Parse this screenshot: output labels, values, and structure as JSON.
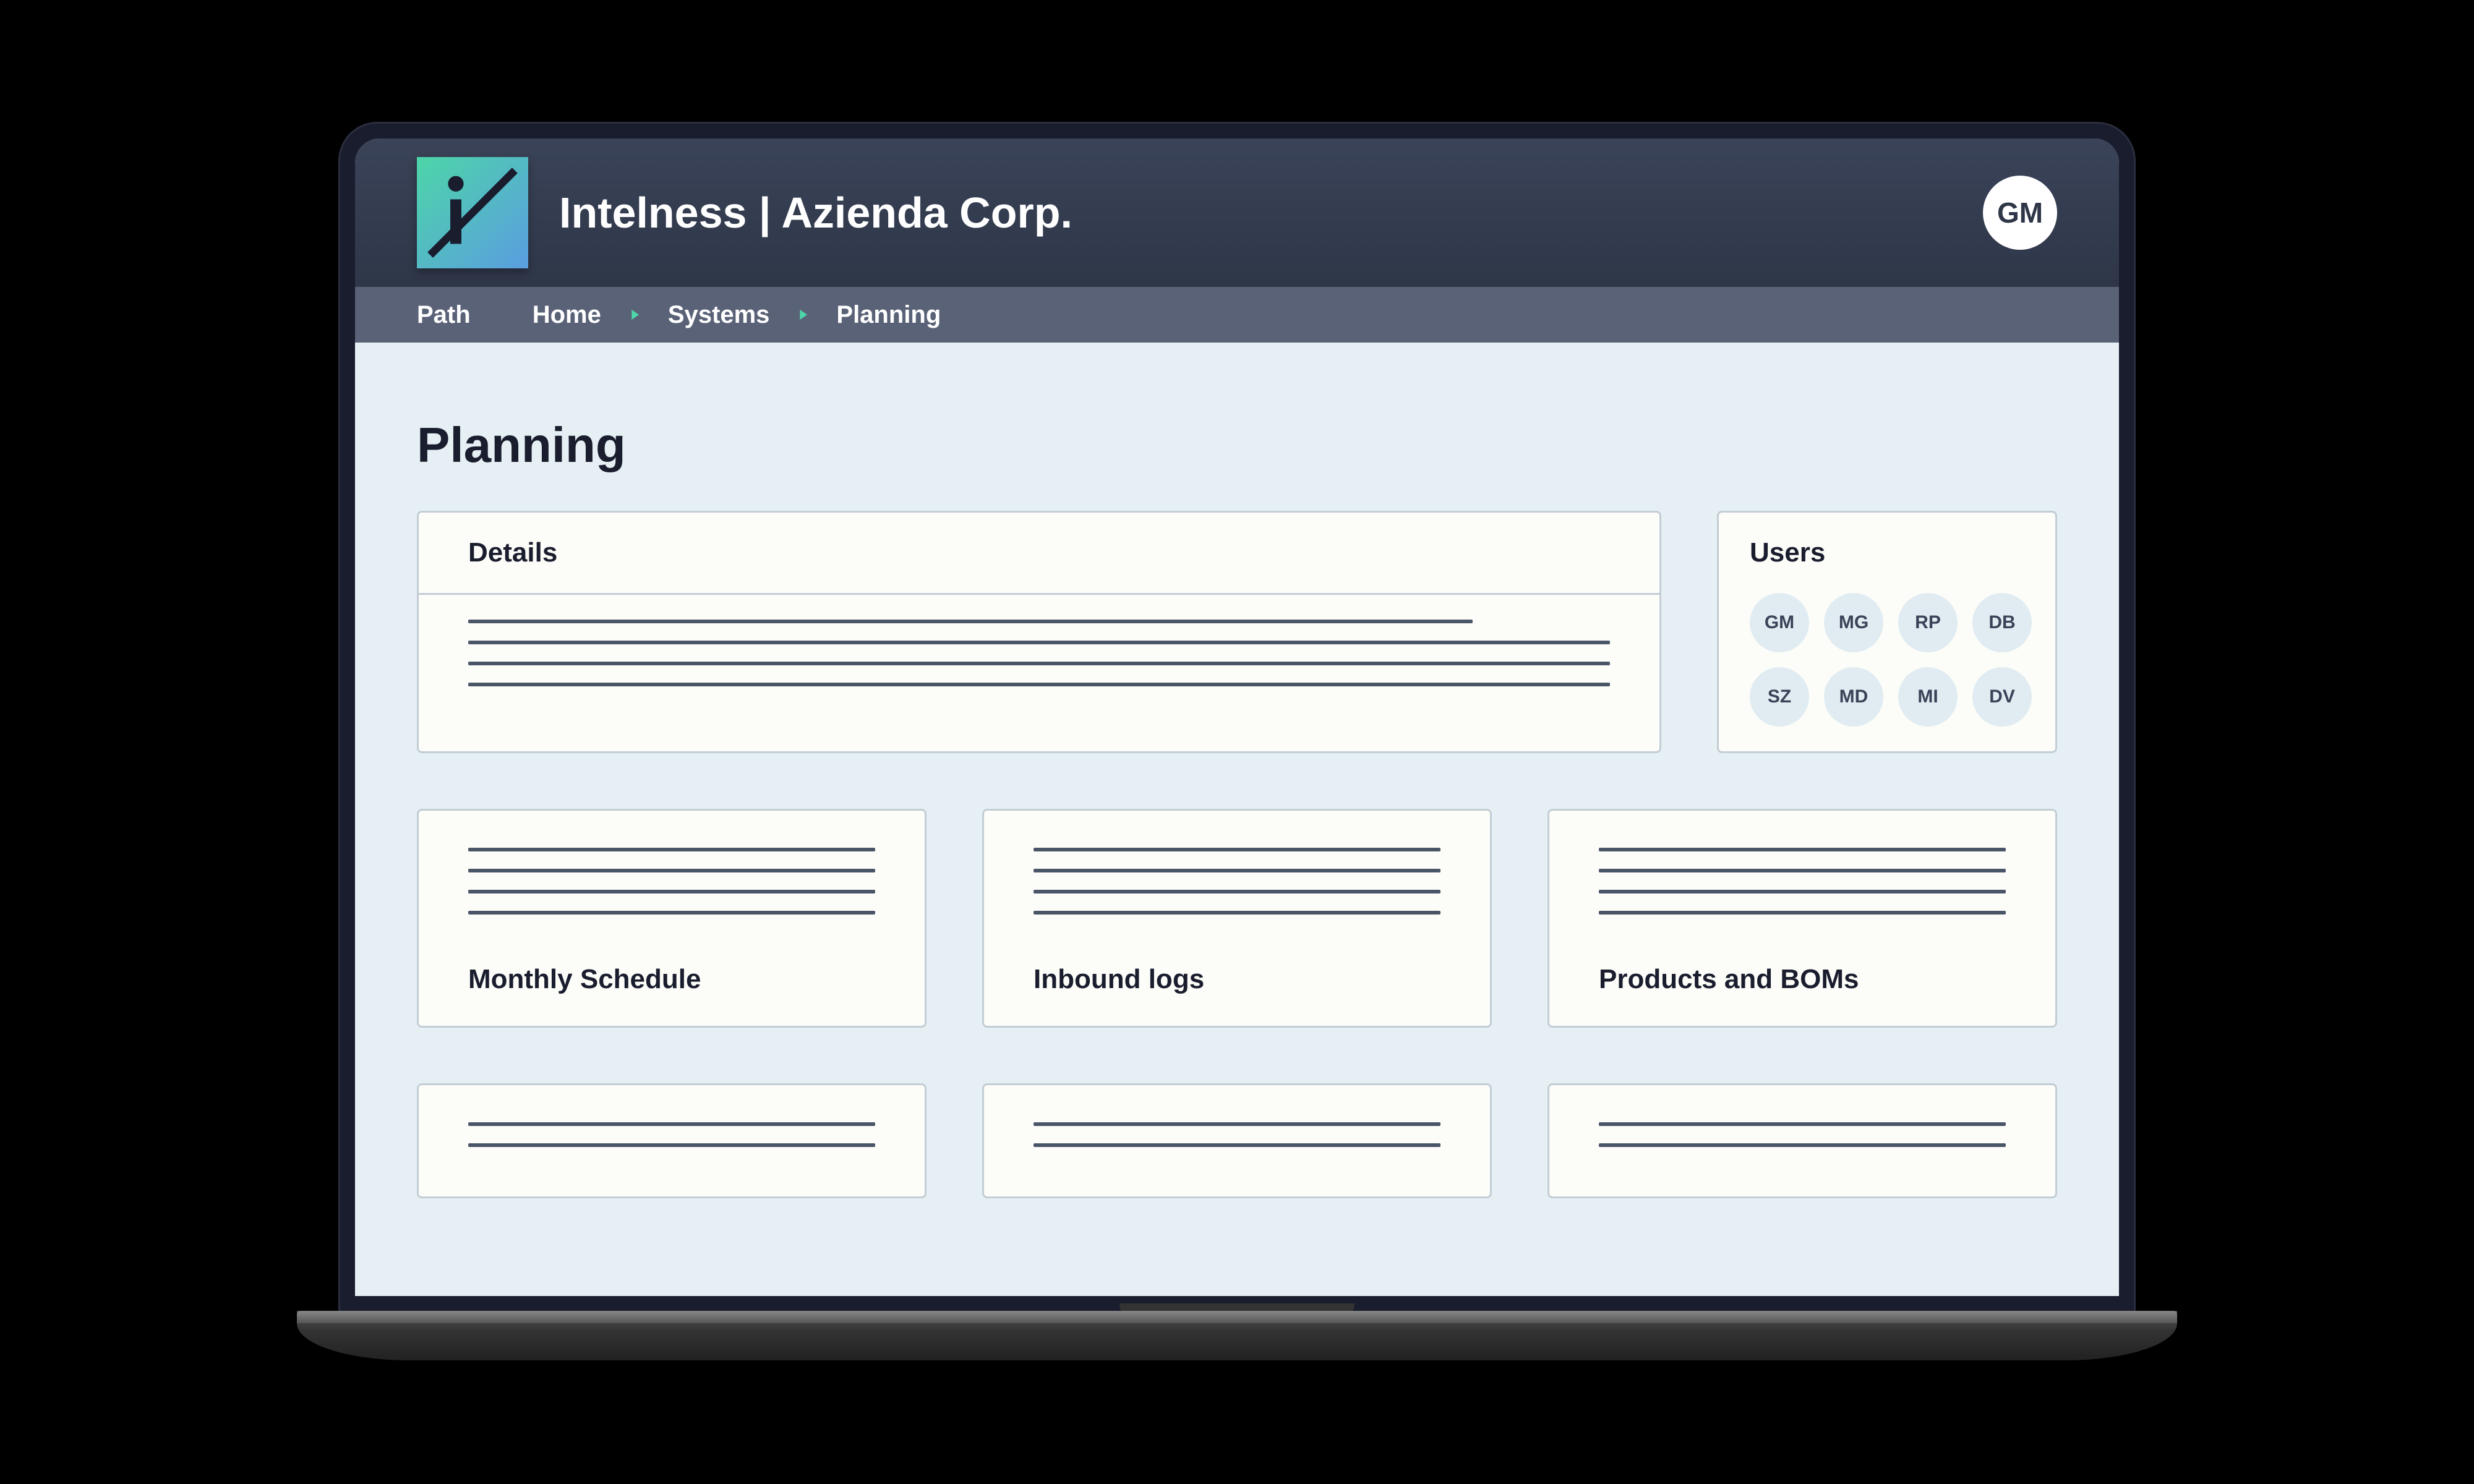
{
  "header": {
    "title": "Intelness | Azienda Corp.",
    "avatar_initials": "GM"
  },
  "breadcrumb": {
    "label": "Path",
    "items": [
      "Home",
      "Systems",
      "Planning"
    ]
  },
  "page": {
    "title": "Planning"
  },
  "details": {
    "title": "Details"
  },
  "users_panel": {
    "title": "Users",
    "users": [
      "GM",
      "MG",
      "RP",
      "DB",
      "SZ",
      "MD",
      "MI",
      "DV"
    ]
  },
  "cards": [
    {
      "title": "Monthly Schedule"
    },
    {
      "title": "Inbound logs"
    },
    {
      "title": "Products and BOMs"
    }
  ],
  "colors": {
    "header_bg": "#2e3648",
    "breadcrumb_bg": "#5a6278",
    "accent": "#4dd6a8",
    "page_bg": "#e6f0f4",
    "card_bg": "#fcfdf8",
    "card_border": "#c3cdd6"
  }
}
